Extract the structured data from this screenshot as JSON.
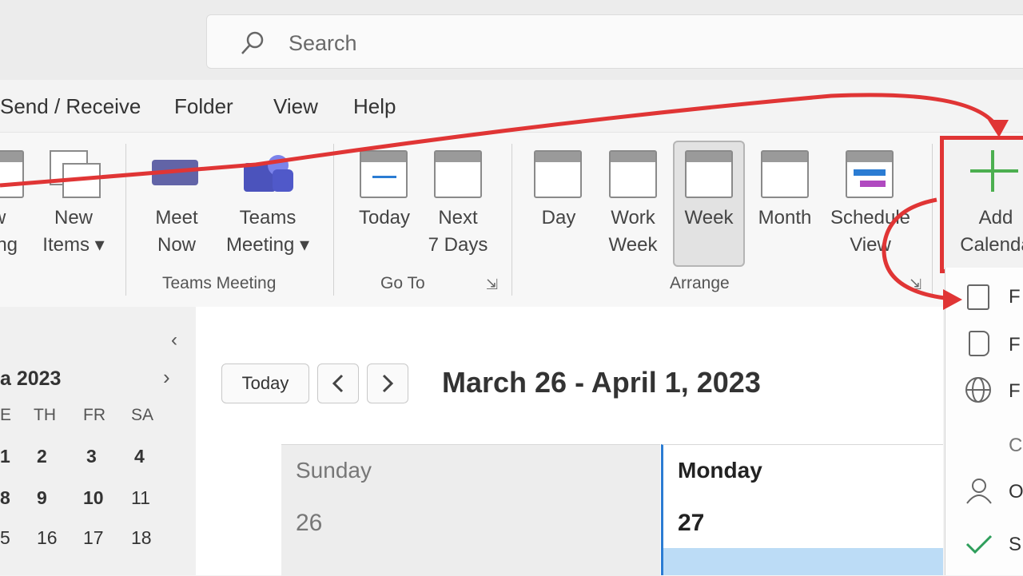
{
  "search": {
    "placeholder": "Search"
  },
  "menu": [
    "Send / Receive",
    "Folder",
    "View",
    "Help"
  ],
  "ribbon": {
    "new_group": [
      {
        "line1": "w",
        "line2": "ing"
      },
      {
        "line1": "New",
        "line2": "Items ▾"
      }
    ],
    "teams_group": {
      "label": "Teams Meeting",
      "items": [
        {
          "line1": "Meet",
          "line2": "Now"
        },
        {
          "line1": "Teams",
          "line2": "Meeting ▾"
        }
      ]
    },
    "goto_group": {
      "label": "Go To",
      "items": [
        {
          "line1": "Today",
          "line2": ""
        },
        {
          "line1": "Next",
          "line2": "7 Days"
        }
      ]
    },
    "arrange_group": {
      "label": "Arrange",
      "items": [
        {
          "line1": "Day",
          "line2": ""
        },
        {
          "line1": "Work",
          "line2": "Week"
        },
        {
          "line1": "Week",
          "line2": ""
        },
        {
          "line1": "Month",
          "line2": ""
        },
        {
          "line1": "Schedule",
          "line2": "View"
        }
      ]
    },
    "add_calendar": {
      "line1": "Add",
      "line2": "Calenda"
    }
  },
  "mini_calendar": {
    "month": "a 2023",
    "day_headers": [
      "E",
      "TH",
      "FR",
      "SA"
    ],
    "rows": [
      [
        "1",
        "2",
        "3",
        "4"
      ],
      [
        "8",
        "9",
        "10",
        "11"
      ],
      [
        "5",
        "16",
        "17",
        "18"
      ]
    ]
  },
  "main": {
    "today_label": "Today",
    "prev_icon": "chevron-left-icon",
    "next_icon": "chevron-right-icon",
    "title": "March 26 - April 1, 2023",
    "columns": [
      {
        "day": "Sunday",
        "date": "26"
      },
      {
        "day": "Monday",
        "date": "27"
      }
    ]
  },
  "flyout_items": [
    {
      "icon": "calendar-grid-icon",
      "text": "F"
    },
    {
      "icon": "calendar-book-icon",
      "text": "F"
    },
    {
      "icon": "globe-icon",
      "text": "F"
    },
    {
      "icon": "",
      "text": "C"
    },
    {
      "icon": "people-icon",
      "text": "O"
    },
    {
      "icon": "checkmark-icon",
      "text": "S"
    }
  ],
  "colors": {
    "annotation": "#e03535",
    "accent": "#2b7cd3",
    "selected": "#bcdcf6"
  }
}
